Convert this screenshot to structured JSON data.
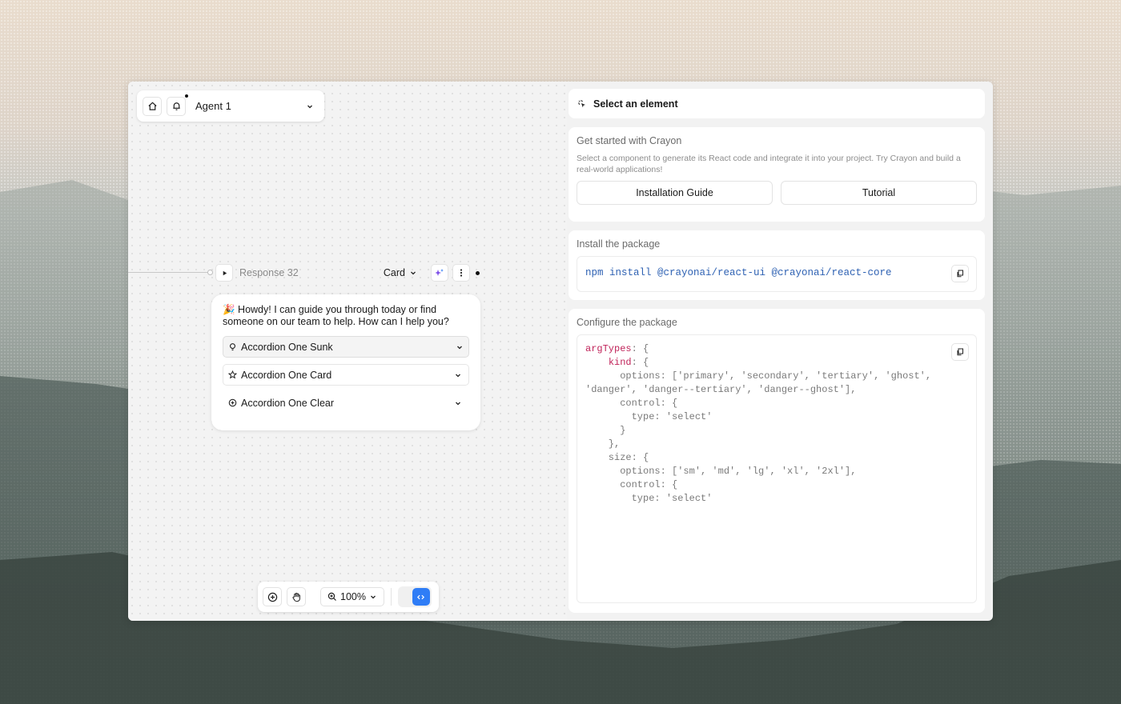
{
  "agent_bar": {
    "agent_name": "Agent 1"
  },
  "response_node": {
    "title": "Response 32",
    "type_selector": "Card",
    "greeting": "🎉 Howdy! I can guide you through today or find someone on our team to help. How can I help you?",
    "accordions": [
      {
        "label": "Accordion One Sunk",
        "icon": "lightbulb-icon"
      },
      {
        "label": "Accordion One Card",
        "icon": "star-icon"
      },
      {
        "label": "Accordion One Clear",
        "icon": "plus-circle-icon"
      }
    ]
  },
  "toolbar": {
    "zoom": "100%"
  },
  "panel": {
    "select_element": "Select an element",
    "get_started": {
      "title": "Get started with Crayon",
      "description": "Select a component to generate its React code and integrate it into your project. Try Crayon and build a real-world applications!",
      "buttons": [
        "Installation Guide",
        "Tutorial"
      ]
    },
    "install": {
      "title": "Install the package",
      "command": "npm install @crayonai/react-ui @crayonai/react-core"
    },
    "configure": {
      "title": "Configure the package",
      "code_key_1": "argTypes",
      "code_key_2": "kind",
      "code_rest_1": "options: ['primary', 'secondary', 'tertiary', 'ghost',\n'danger', 'danger--tertiary', 'danger--ghost'],\n      control: {\n        type: 'select'\n      }\n    },\n    size: {\n      options: ['sm', 'md', 'lg', 'xl', '2xl'],\n      control: {\n        type: 'select'"
    }
  },
  "colors": {
    "accent": "#2f7df6",
    "code_keyword": "#c0245a",
    "code_command": "#2f62b3"
  }
}
